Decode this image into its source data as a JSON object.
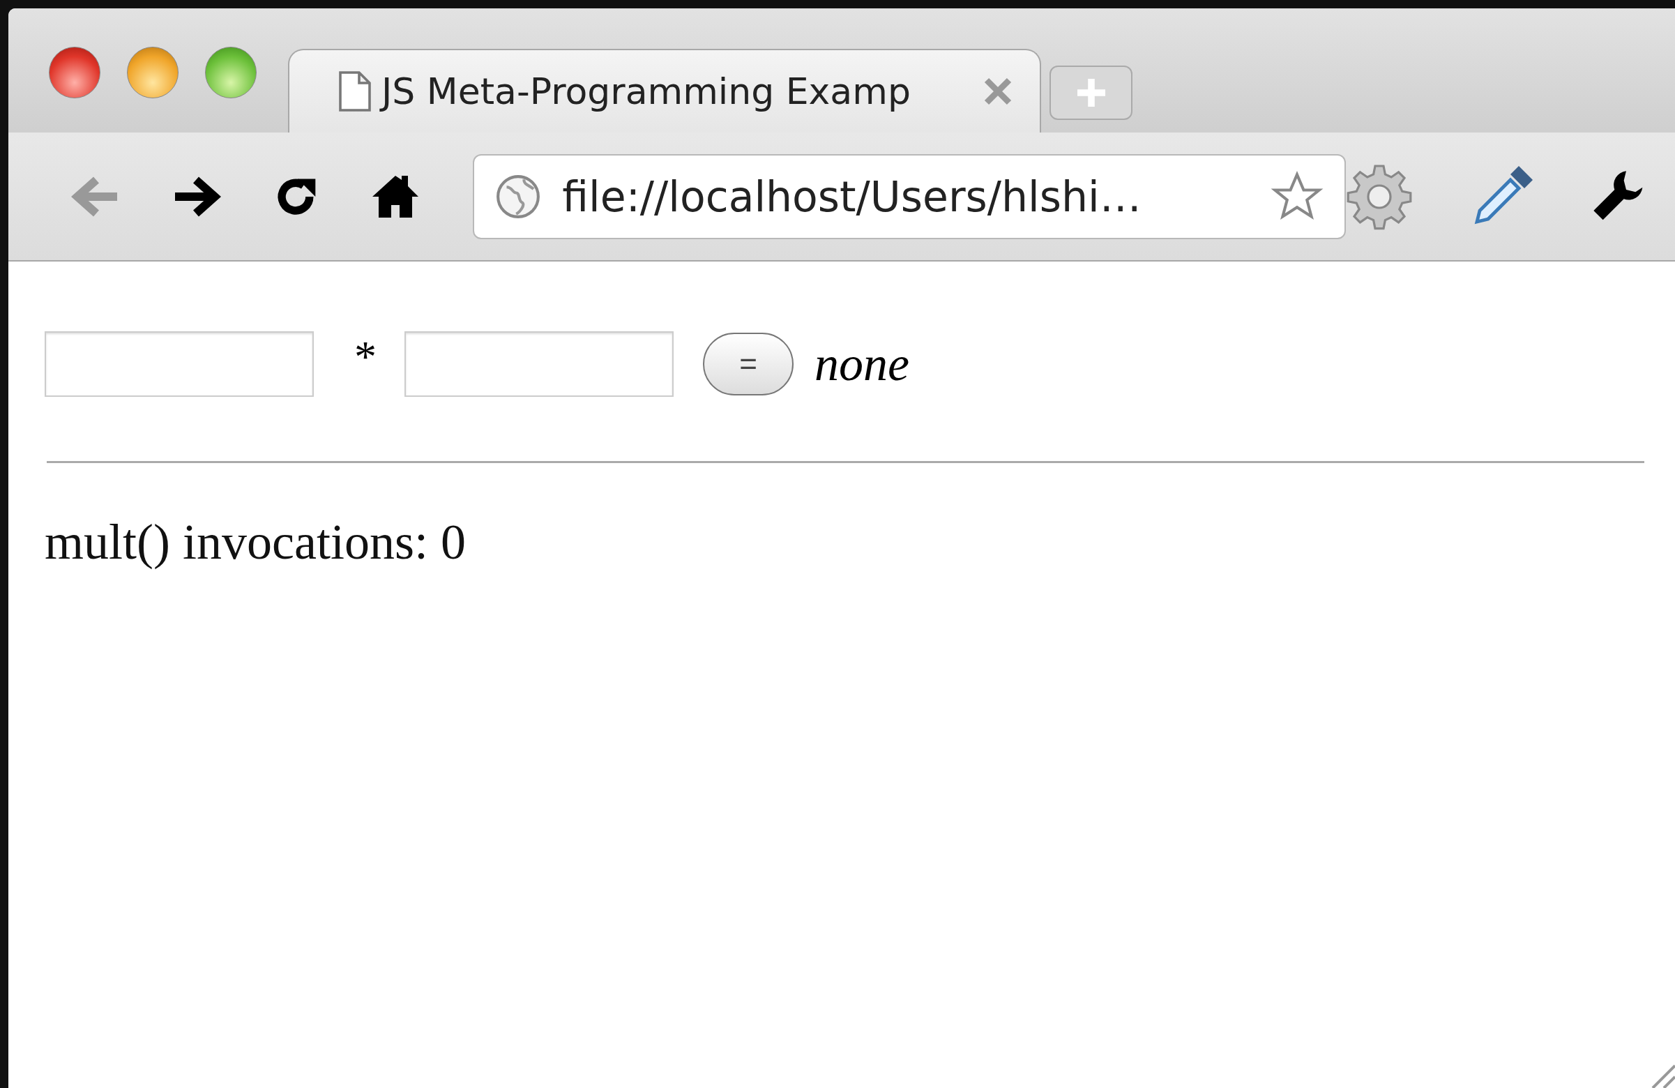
{
  "tabs": [
    {
      "title": "JS Meta-Programming Examp",
      "selected": true
    }
  ],
  "toolbar": {
    "buttons": [
      {
        "kind": "back",
        "disabled": true
      },
      {
        "kind": "forward",
        "disabled": false
      },
      {
        "kind": "reload",
        "disabled": false
      },
      {
        "kind": "home",
        "disabled": false
      }
    ],
    "address": "file://localhost/Users/hlshi…"
  },
  "form": {
    "operator": "*",
    "button": "=",
    "result": "none"
  },
  "status": "mult() invocations: 0"
}
